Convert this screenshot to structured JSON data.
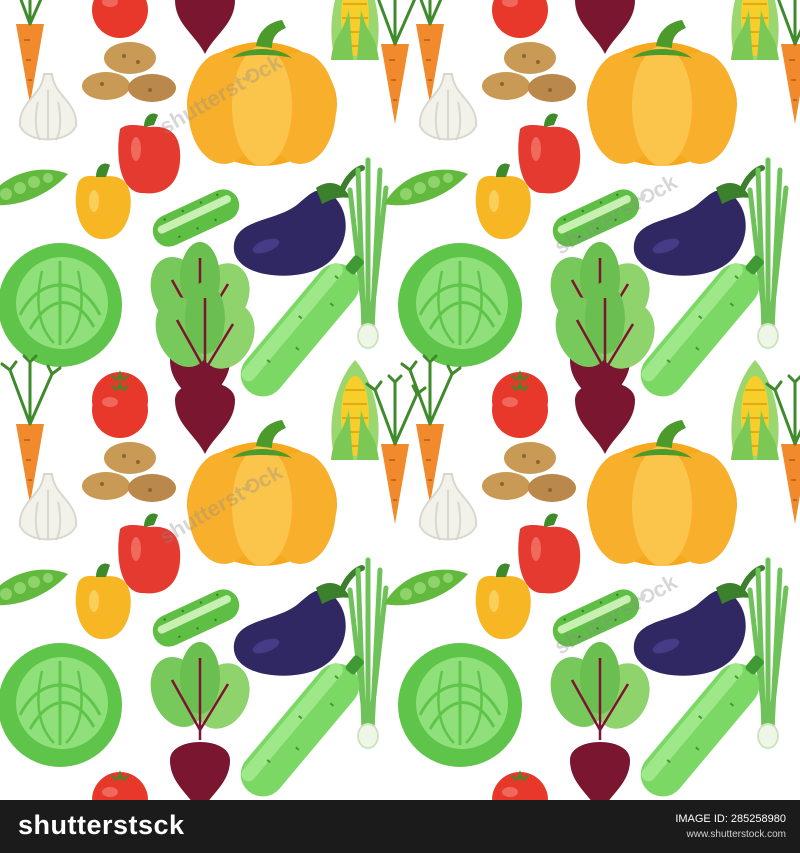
{
  "image": {
    "description_kind": "seamless vegetable pattern",
    "background_color": "#ffffff",
    "vegetables": [
      "carrot",
      "tomato",
      "beet",
      "cabbage",
      "corn",
      "potato",
      "pumpkin",
      "garlic",
      "bell-pepper-red",
      "bell-pepper-yellow",
      "peas",
      "cucumber",
      "eggplant",
      "green-onion",
      "zucchini"
    ],
    "colors": {
      "pumpkin": "#f7a91d",
      "pumpkin_light": "#fbc44a",
      "pumpkin_stem": "#4c9a2a",
      "eggplant": "#2f2863",
      "eggplant_cap": "#3c7f2c",
      "cabbage": "#5ec44a",
      "cabbage_light": "#8fe07a",
      "zucchini": "#7bd864",
      "zucchini_dark": "#3f9a33",
      "beet": "#7a1630",
      "beet_leaf": "#76c95a",
      "carrot": "#f08a2c",
      "carrot_top": "#3f8a2a",
      "tomato": "#e8382b",
      "pepper_red": "#e43a30",
      "pepper_yellow": "#f7b623",
      "corn": "#f6cf2b",
      "corn_husk": "#9ad86f",
      "potato": "#c99a55",
      "garlic": "#f2f1ea",
      "peas": "#62b93e",
      "cucumber": "#5fbf45",
      "onion": "#6fc15a"
    },
    "watermark_text": "shutterst⟲ck",
    "watermark_color": "rgba(140,140,140,0.35)"
  },
  "footer": {
    "brand": "shutterstsck",
    "image_id": "IMAGE ID: 285258980",
    "url": "www.shutterstock.com",
    "background": "#1b1b1b"
  }
}
